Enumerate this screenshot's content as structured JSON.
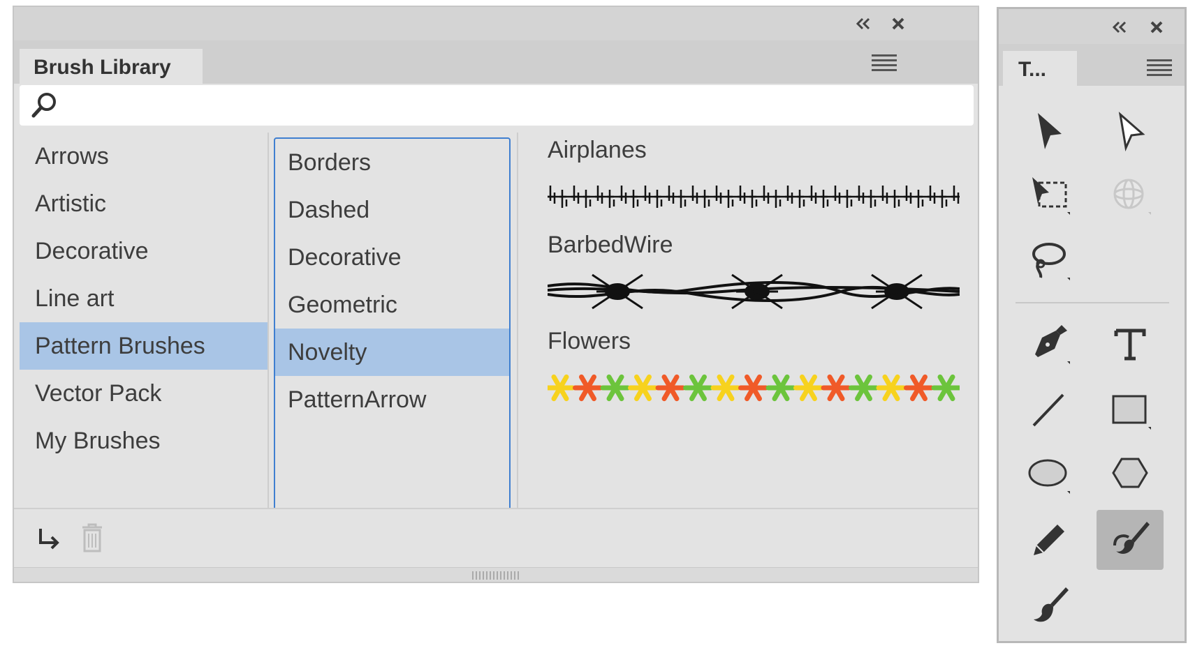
{
  "brush_library": {
    "title": "Brush Library",
    "search_placeholder": "",
    "categories": [
      "Arrows",
      "Artistic",
      "Decorative",
      "Line art",
      "Pattern Brushes",
      "Vector Pack",
      "My Brushes"
    ],
    "selected_category": "Pattern Brushes",
    "subcategories": [
      "Borders",
      "Dashed",
      "Decorative",
      "Geometric",
      "Novelty",
      "PatternArrow"
    ],
    "selected_subcategory": "Novelty",
    "brushes": [
      {
        "name": "Airplanes"
      },
      {
        "name": "BarbedWire"
      },
      {
        "name": "Flowers",
        "colors": [
          "#f7d21e",
          "#f05a28",
          "#6cc43c"
        ]
      }
    ]
  },
  "tools_panel": {
    "tab_label": "T...",
    "tools": [
      "selection-tool",
      "direct-selection-tool",
      "free-transform-tool",
      "3d-rotate-tool",
      "lasso-tool",
      "pen-tool",
      "type-tool",
      "line-tool",
      "rectangle-tool",
      "ellipse-tool",
      "polygon-tool",
      "pencil-tool",
      "paintbrush-tool",
      "blob-brush-tool"
    ],
    "active_tool": "paintbrush-tool"
  },
  "colors": {
    "selection": "#a9c5e6",
    "focus_border": "#3f7fd0",
    "panel_bg": "#e3e3e3"
  }
}
